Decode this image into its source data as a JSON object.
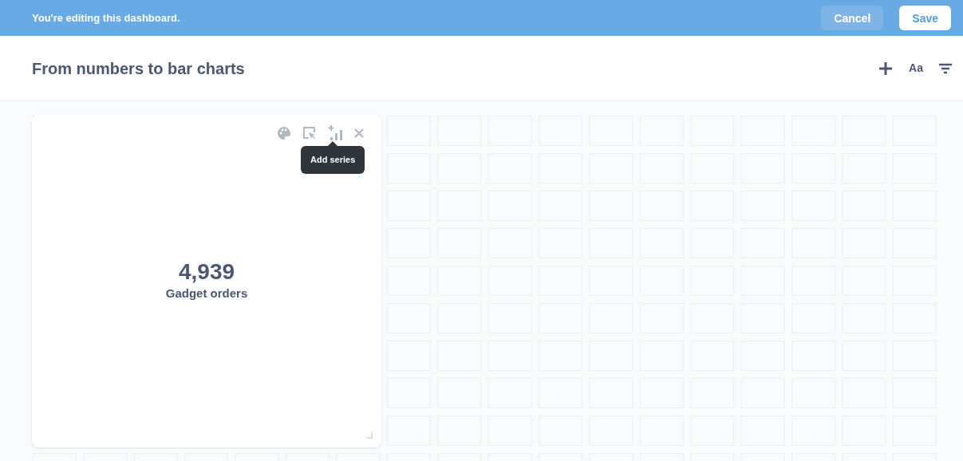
{
  "edit_banner": {
    "message": "You're editing this dashboard.",
    "buttons": [
      {
        "kind": "secondary",
        "label": "Cancel"
      },
      {
        "kind": "primary",
        "label": "Save"
      }
    ]
  },
  "header": {
    "title": "From numbers to bar charts",
    "text_button": "Aa"
  },
  "card": {
    "value": "4,939",
    "label": "Gadget orders",
    "tooltip": "Add series"
  }
}
